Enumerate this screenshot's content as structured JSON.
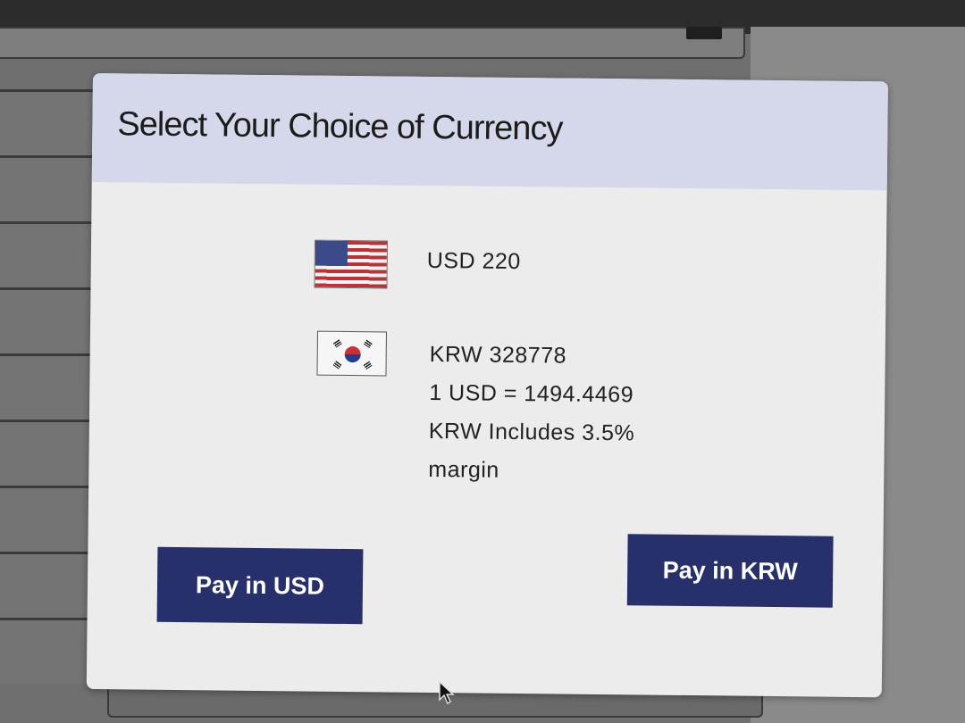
{
  "dialog": {
    "title": "Select Your Choice of Currency",
    "options": {
      "usd": {
        "flag_icon": "us-flag-icon",
        "amount_text": "USD 220"
      },
      "krw": {
        "flag_icon": "kr-flag-icon",
        "amount_text": "KRW 328778",
        "rate_text": "1 USD = 1494.4469",
        "note_line1": "KRW Includes 3.5%",
        "note_line2": "margin"
      }
    },
    "buttons": {
      "pay_usd": "Pay in USD",
      "pay_krw": "Pay in KRW"
    }
  },
  "colors": {
    "header_bg": "#d5d7ea",
    "dialog_bg": "#ececec",
    "button_bg": "#27306a",
    "button_text": "#ffffff"
  }
}
